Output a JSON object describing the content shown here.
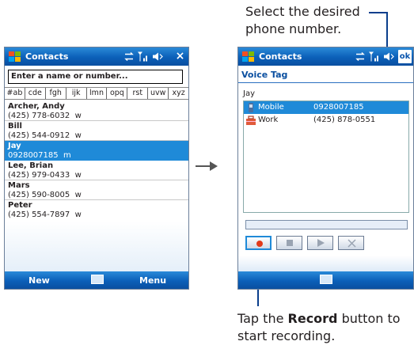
{
  "annotations": {
    "top_note": "Select the desired phone number.",
    "top_note_line1": "Select the desired",
    "top_note_line2": "phone number.",
    "bottom_note_prefix": "Tap the ",
    "bottom_note_bold": "Record",
    "bottom_note_suffix": " button to",
    "bottom_note_line2": "start recording."
  },
  "left_screen": {
    "title": "Contacts",
    "search_placeholder": "Enter a name or number...",
    "letter_tabs": [
      "#ab",
      "cde",
      "fgh",
      "ijk",
      "lmn",
      "opq",
      "rst",
      "uvw",
      "xyz"
    ],
    "contacts": [
      {
        "name": "Archer, Andy",
        "phone": "(425) 778-6032",
        "type": "w",
        "selected": false
      },
      {
        "name": "Bill",
        "phone": "(425) 544-0912",
        "type": "w",
        "selected": false
      },
      {
        "name": "Jay",
        "phone": "0928007185",
        "type": "m",
        "selected": true
      },
      {
        "name": "Lee, Brian",
        "phone": "(425) 979-0433",
        "type": "w",
        "selected": false
      },
      {
        "name": "Mars",
        "phone": "(425) 590-8005",
        "type": "w",
        "selected": false
      },
      {
        "name": "Peter",
        "phone": "(425) 554-7897",
        "type": "w",
        "selected": false
      }
    ],
    "menu_left": "New",
    "menu_right": "Menu",
    "close_label": "×"
  },
  "right_screen": {
    "title": "Contacts",
    "ok_label": "ok",
    "header": "Voice Tag",
    "contact_name": "Jay",
    "numbers": [
      {
        "type": "Mobile",
        "number": "0928007185",
        "selected": true,
        "icon": "mobile-phone-icon"
      },
      {
        "type": "Work",
        "number": "(425) 878-0551",
        "selected": false,
        "icon": "work-briefcase-icon"
      }
    ],
    "controls": [
      "record-icon",
      "stop-icon",
      "play-icon",
      "delete-icon"
    ]
  },
  "colors": {
    "title_bar": "#0b5fb8",
    "selection": "#1f8ad8",
    "record_dot": "#e23a1a",
    "callout_line": "#0a3e8c"
  }
}
